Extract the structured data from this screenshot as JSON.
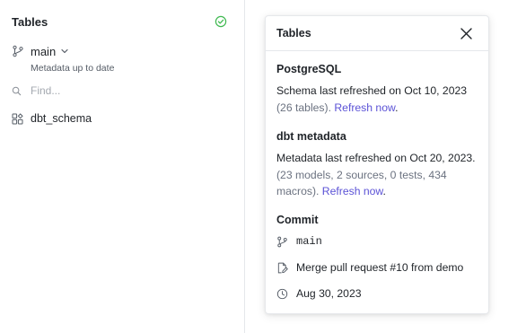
{
  "sidebar": {
    "title": "Tables",
    "branch": "main",
    "metadata_status": "Metadata up to date",
    "search": {
      "placeholder": "Find..."
    },
    "items": [
      {
        "label": "dbt_schema",
        "icon": "schema-icon"
      }
    ]
  },
  "popover": {
    "title": "Tables",
    "postgres": {
      "heading": "PostgreSQL",
      "text": "Schema last refreshed on Oct 10, 2023",
      "detail": "(26 tables).",
      "link": "Refresh now",
      "suffix": "."
    },
    "dbt": {
      "heading": "dbt metadata",
      "text": "Metadata last refreshed on Oct 20, 2023.",
      "detail": "(23 models, 2 sources, 0 tests, 434 macros).",
      "link": "Refresh now",
      "suffix": "."
    },
    "commit": {
      "heading": "Commit",
      "branch": "main",
      "message": "Merge pull request #10 from demo",
      "date": "Aug 30, 2023"
    }
  },
  "colors": {
    "accent_link": "#5b52d6",
    "status_ok": "#3fb950"
  }
}
